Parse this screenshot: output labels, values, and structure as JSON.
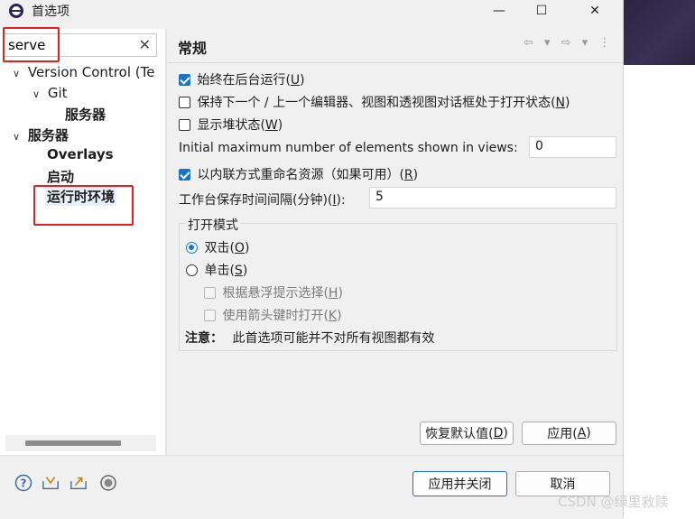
{
  "window": {
    "title": "首选项",
    "minimize": "—",
    "maximize": "☐",
    "close": "✕"
  },
  "search": {
    "value": "serve",
    "clear_icon": "✕"
  },
  "tree": {
    "items": [
      {
        "label": "Version Control (Te",
        "arrow": "∨"
      },
      {
        "label": "Git",
        "arrow": "∨"
      },
      {
        "label": "服务器"
      },
      {
        "label": "服务器",
        "arrow": "∨"
      },
      {
        "label": "Overlays"
      },
      {
        "label": "启动"
      },
      {
        "label": "运行时环境"
      }
    ]
  },
  "page": {
    "title": "常规",
    "nav": "⇦ ▾ ⇨ ▾ ⋮",
    "options": [
      {
        "label": "始终在后台运行(",
        "key": "U",
        "end": ")",
        "checked": true
      },
      {
        "label": "保持下一个 / 上一个编辑器、视图和透视图对话框处于打开状态(",
        "key": "N",
        "end": ")",
        "checked": false
      },
      {
        "label": "显示堆状态(",
        "key": "W",
        "end": ")",
        "checked": false
      }
    ],
    "max_elements": {
      "label": "Initial maximum number of elements shown in views:",
      "value": "0"
    },
    "rename_inline": {
      "label": "以内联方式重命名资源（如果可用）(",
      "key": "R",
      "end": ")",
      "checked": true
    },
    "save_interval": {
      "label": "工作台保存时间间隔(分钟)(",
      "key": "I",
      "end": "):",
      "value": "5"
    },
    "open_mode": {
      "title": "打开模式",
      "double": {
        "label": "双击(",
        "key": "O",
        "end": ")",
        "selected": true
      },
      "single": {
        "label": "单击(",
        "key": "S",
        "end": ")",
        "selected": false
      },
      "hover": {
        "label": "根据悬浮提示选择(",
        "key": "H",
        "end": ")"
      },
      "arrow": {
        "label": "使用箭头键时打开(",
        "key": "K",
        "end": ")"
      },
      "note_label": "注意：",
      "note_text": "此首选项可能并不对所有视图都有效"
    },
    "restore_button": {
      "label": "恢复默认值(",
      "key": "D",
      "end": ")"
    },
    "apply_button": {
      "label": "应用(",
      "key": "A",
      "end": ")"
    }
  },
  "footer": {
    "apply_close": "应用并关闭",
    "cancel": "取消",
    "icons": [
      "help-icon",
      "import-icon",
      "export-icon",
      "record-icon"
    ]
  },
  "watermark": "CSDN @绿里救赎",
  "colors": {
    "accent": "#1a73c8",
    "annotation_red": "#e81e1e"
  }
}
